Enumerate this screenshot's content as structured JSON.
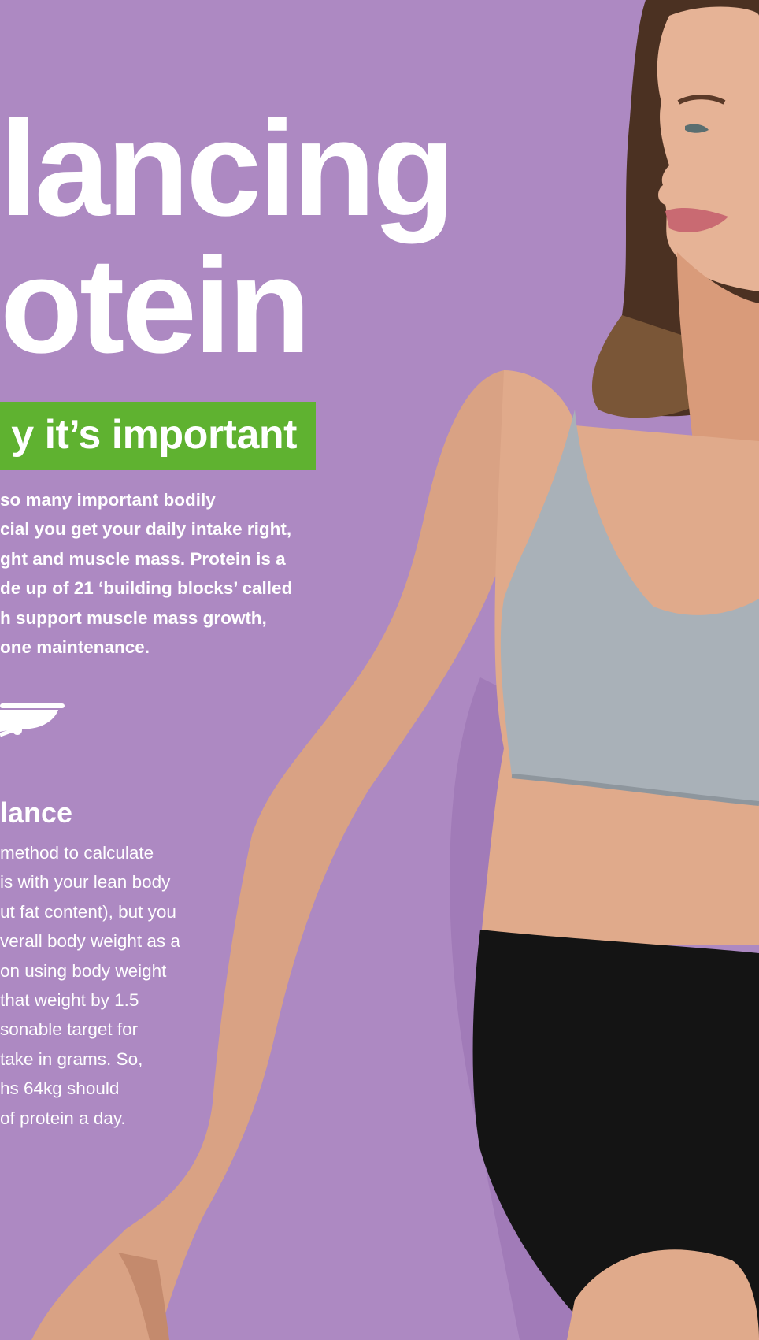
{
  "heading": {
    "line1": "lancing",
    "line2": "otein"
  },
  "banner": {
    "text": "y it’s important"
  },
  "intro_lines": [
    "so many important bodily",
    "cial you get your daily intake right,",
    "ght and muscle mass. Protein is a",
    "de up of 21 ‘building blocks’ called",
    "h support muscle mass growth,",
    "one maintenance."
  ],
  "section": {
    "heading": "lance",
    "lines": [
      "method to calculate",
      "is with your lean body",
      "ut fat content), but you",
      "verall body weight as a",
      "on using body weight",
      "that weight by 1.5",
      "sonable target for",
      "take in grams. So,",
      "hs 64kg should",
      "of protein a day."
    ]
  },
  "icons": {
    "scale": "scale-icon"
  },
  "colors": {
    "background": "#ad89c2",
    "banner": "#5fb230",
    "text": "#ffffff"
  }
}
